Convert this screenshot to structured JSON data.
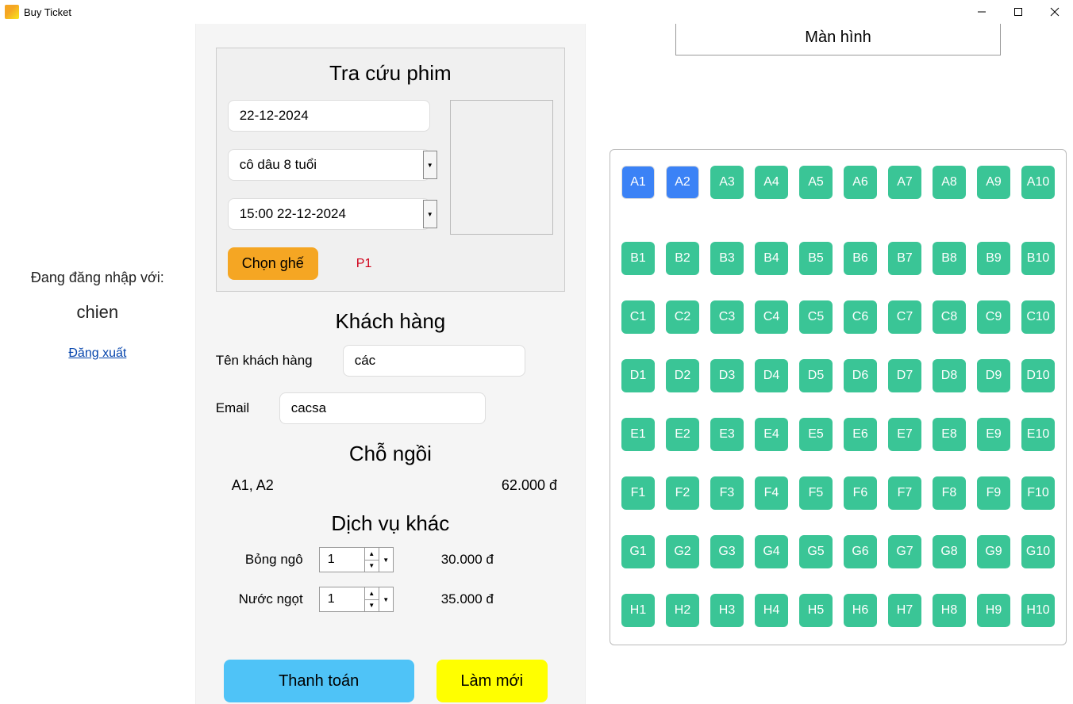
{
  "window": {
    "title": "Buy Ticket"
  },
  "login": {
    "label": "Đang đăng nhập với:",
    "user": "chien",
    "logout": "Đăng xuất"
  },
  "lookup": {
    "title": "Tra cứu phim",
    "date": "22-12-2024",
    "movie": "cô dâu 8 tuổi",
    "showtime": "15:00 22-12-2024",
    "choose_seat": "Chọn ghế",
    "room": "P1"
  },
  "customer": {
    "title": "Khách hàng",
    "name_label": "Tên khách hàng",
    "name_value": "các",
    "email_label": "Email",
    "email_value": "cacsa"
  },
  "seats": {
    "title": "Chỗ ngồi",
    "selected": "A1, A2",
    "price": "62.000 đ"
  },
  "services": {
    "title": "Dịch vụ khác",
    "items": [
      {
        "label": "Bỏng ngô",
        "qty": "1",
        "price": "30.000 đ"
      },
      {
        "label": "Nước ngọt",
        "qty": "1",
        "price": "35.000 đ"
      }
    ]
  },
  "actions": {
    "pay": "Thanh toán",
    "reset": "Làm mới"
  },
  "screen": {
    "label": "Màn hình"
  },
  "grid": {
    "rows": [
      "A",
      "B",
      "C",
      "D",
      "E",
      "F",
      "G",
      "H"
    ],
    "cols": 10,
    "selected": [
      "A1",
      "A2"
    ]
  }
}
